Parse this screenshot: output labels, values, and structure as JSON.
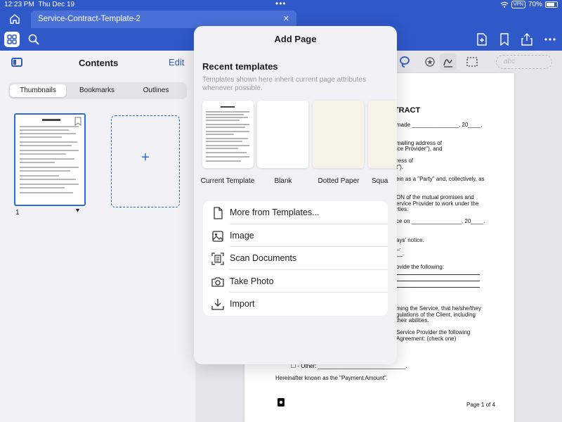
{
  "status": {
    "time": "12:23 PM",
    "date": "Thu Dec 19",
    "vpn": "VPN",
    "battery": "70%"
  },
  "tabs": {
    "active_title": "Service-Contract-Template 2"
  },
  "sidebar": {
    "title": "Contents",
    "edit_label": "Edit",
    "segments": [
      "Thumbnails",
      "Bookmarks",
      "Outlines"
    ],
    "active_segment": "Thumbnails",
    "page_number": "1",
    "add_symbol": "+"
  },
  "popover": {
    "title": "Add Page",
    "recent_title": "Recent templates",
    "recent_desc": "Templates shown here inherit current page attributes whenever possible.",
    "templates": [
      "Current Template",
      "Blank",
      "Dotted Paper",
      "Squa"
    ],
    "menu": [
      "More from Templates...",
      "Image",
      "Scan Documents",
      "Take Photo",
      "Import"
    ]
  },
  "annotation_bar": {
    "text_field_placeholder": "abc"
  },
  "document": {
    "heading": "CTRACT",
    "lines": [
      "made _______________, 20____,",
      "mailing address of",
      "ice Provider\"), and",
      "ress of",
      "t\").",
      "ein as a \"Party\" and, collectively, as",
      "ON of the mutual promises and",
      "ervice Provider to work under the",
      "rties:",
      "ce on ________________, 20____.",
      "ays' notice.",
      "_.",
      "__.",
      "ovide the following:",
      "ming the Service, that he/she/they",
      "gulations of the Client, including",
      "their abilities.",
      "Service Provider the following",
      "Agreement: (check one)",
      "☐ - Other: ____________________________.",
      "Hereinafter known as the \"Payment Amount\".",
      "Page 1 of 4"
    ]
  }
}
